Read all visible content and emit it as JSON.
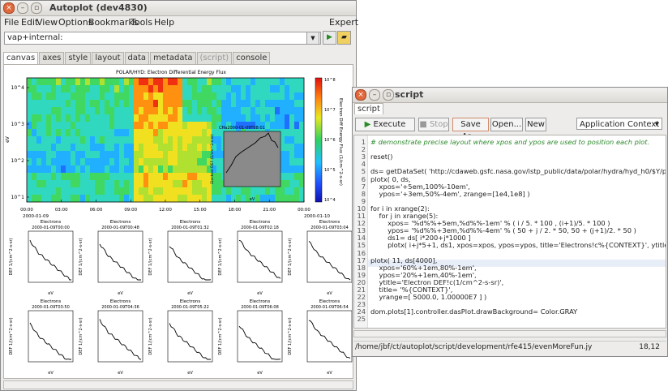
{
  "main_window": {
    "title": "Autoplot (dev4830)",
    "menus": [
      "File",
      "Edit",
      "View",
      "Options",
      "Bookmarks",
      "Tools",
      "Help"
    ],
    "expert_label": "Expert",
    "address_value": "vap+internal:",
    "tabs": [
      "canvas",
      "axes",
      "style",
      "layout",
      "data",
      "metadata",
      "(script)",
      "console"
    ],
    "top_plot": {
      "title": "POLAR/HYD: Electron Differential Energy Flux",
      "ylabel": "eV",
      "colorbar_label": "Electron Diff Energy Flux (1/cm^2-s-sr)",
      "colorbar_ticks": [
        "10^8",
        "10^7",
        "10^6",
        "10^5",
        "10^4"
      ],
      "y_ticks": [
        "10^4",
        "10^3",
        "10^2",
        "10^1"
      ],
      "x_ticks": [
        "00:00",
        "03:00",
        "06:00",
        "09:00",
        "12:00",
        "15:00",
        "18:00",
        "21:00",
        "00:00"
      ],
      "x_date_left": "2000-01-09",
      "x_date_right": "2000-01-10",
      "inset_title": "CHa2000-01-09T08:01",
      "inset_ylabel": "Electron DEF (1/cm^2-s-sr)",
      "inset_xlabel": "eV"
    },
    "small_plot_title": "Electrons",
    "small_plot_ylabel": "DEF 1/(cm^2-s-sr)",
    "small_plot_xlabel": "eV",
    "small_plot_times": [
      "2000-01-09T00:00",
      "2000-01-09T00:48",
      "2000-01-09T01:32",
      "2000-01-09T02:18",
      "2000-01-09T03:04",
      "2000-01-09T03:50",
      "2000-01-09T04:36",
      "2000-01-09T05:22",
      "2000-01-09T06:08",
      "2000-01-09T06:54"
    ]
  },
  "script_window": {
    "title": "script",
    "tab": "script",
    "buttons": {
      "execute": "Execute",
      "stop": "Stop",
      "save_as": "Save As...",
      "open": "Open...",
      "new": "New"
    },
    "context": "Application Context",
    "code_lines": [
      "# demonstrate precise layout where xpos and ypos are used to position each plot.",
      "",
      "reset()",
      "",
      "ds= getDataSet( 'http://cdaweb.gsfc.nasa.gov/istp_public/data/polar/hydra/hyd_h0/$Y/po_h0_hyd",
      "plotx( 0, ds,",
      "    xpos='+5em,100%-10em',",
      "    ypos='+3em,50%-4em', zrange=[1e4,1e8] )",
      "",
      "for i in xrange(2):",
      "    for j in xrange(5):",
      "        xpos= '%d%%+5em,%d%%-1em' % ( i / 5. * 100 , (i+1)/5. * 100 )",
      "        ypos= '%d%%+3em,%d%%-4em' % ( 50 + j / 2. * 50, 50 + (j+1)/2. * 50 )",
      "        ds1= ds[ i*200+j*1000 ]",
      "        plotx( i+j*5+1, ds1, xpos=xpos, ypos=ypos, title='Electrons!c%{CONTEXT}', ytitle='DEF %{U",
      "",
      "plotx( 11, ds[4000],",
      "    xpos='60%+1em,80%-1em',",
      "    ypos='20%+1em,40%-1em',",
      "    ytitle='Electron DEF!c(1/cm^2-s-sr)',",
      "    title= '%{CONTEXT}',",
      "    yrange=[ 5000.0, 1.00000E7 ] )",
      "",
      "dom.plots[1].controller.dasPlot.drawBackground= Color.GRAY",
      ""
    ],
    "file_path": "/home/jbf/ct/autoplot/script/development/rfe415/evenMoreFun.jy",
    "caret": "18,12"
  }
}
